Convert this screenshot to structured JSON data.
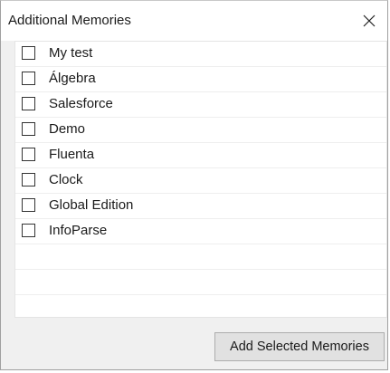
{
  "window": {
    "title": "Additional Memories",
    "close_glyph": "✕"
  },
  "memories": [
    {
      "label": "My test",
      "checked": false
    },
    {
      "label": "Álgebra",
      "checked": false
    },
    {
      "label": "Salesforce",
      "checked": false
    },
    {
      "label": "Demo",
      "checked": false
    },
    {
      "label": "Fluenta",
      "checked": false
    },
    {
      "label": "Clock",
      "checked": false
    },
    {
      "label": "Global Edition",
      "checked": false
    },
    {
      "label": "InfoParse",
      "checked": false
    }
  ],
  "actions": {
    "add_selected_label": "Add Selected Memories"
  },
  "colors": {
    "dialog_bg": "#f0f0f0",
    "list_bg": "#ffffff",
    "button_bg": "#e1e1e1",
    "button_border": "#adadad"
  }
}
